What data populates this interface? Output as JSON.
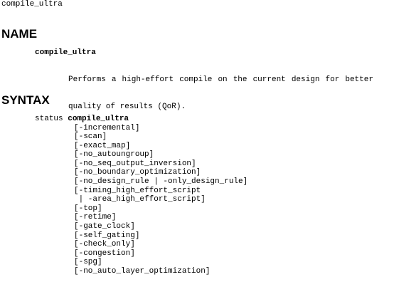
{
  "header": {
    "topic": "compile_ultra"
  },
  "name_section": {
    "title": "NAME",
    "command": "compile_ultra",
    "description_line1_words": [
      "Performs",
      "a",
      "high-effort",
      "compile",
      "on",
      "the",
      "current",
      "design",
      "for",
      "better"
    ],
    "description_line2": "quality of results (QoR)."
  },
  "syntax_section": {
    "title": "SYNTAX",
    "return_type": "status",
    "command": "compile_ultra",
    "options": [
      "[-incremental]",
      "[-scan]",
      "[-exact_map]",
      "[-no_autoungroup]",
      "[-no_seq_output_inversion]",
      "[-no_boundary_optimization]",
      "[-no_design_rule | -only_design_rule]",
      "[-timing_high_effort_script",
      " | -area_high_effort_script]",
      "[-top]",
      "[-retime]",
      "[-gate_clock]",
      "[-self_gating]",
      "[-check_only]",
      "[-congestion]",
      "[-spg]",
      "[-no_auto_layer_optimization]"
    ]
  }
}
